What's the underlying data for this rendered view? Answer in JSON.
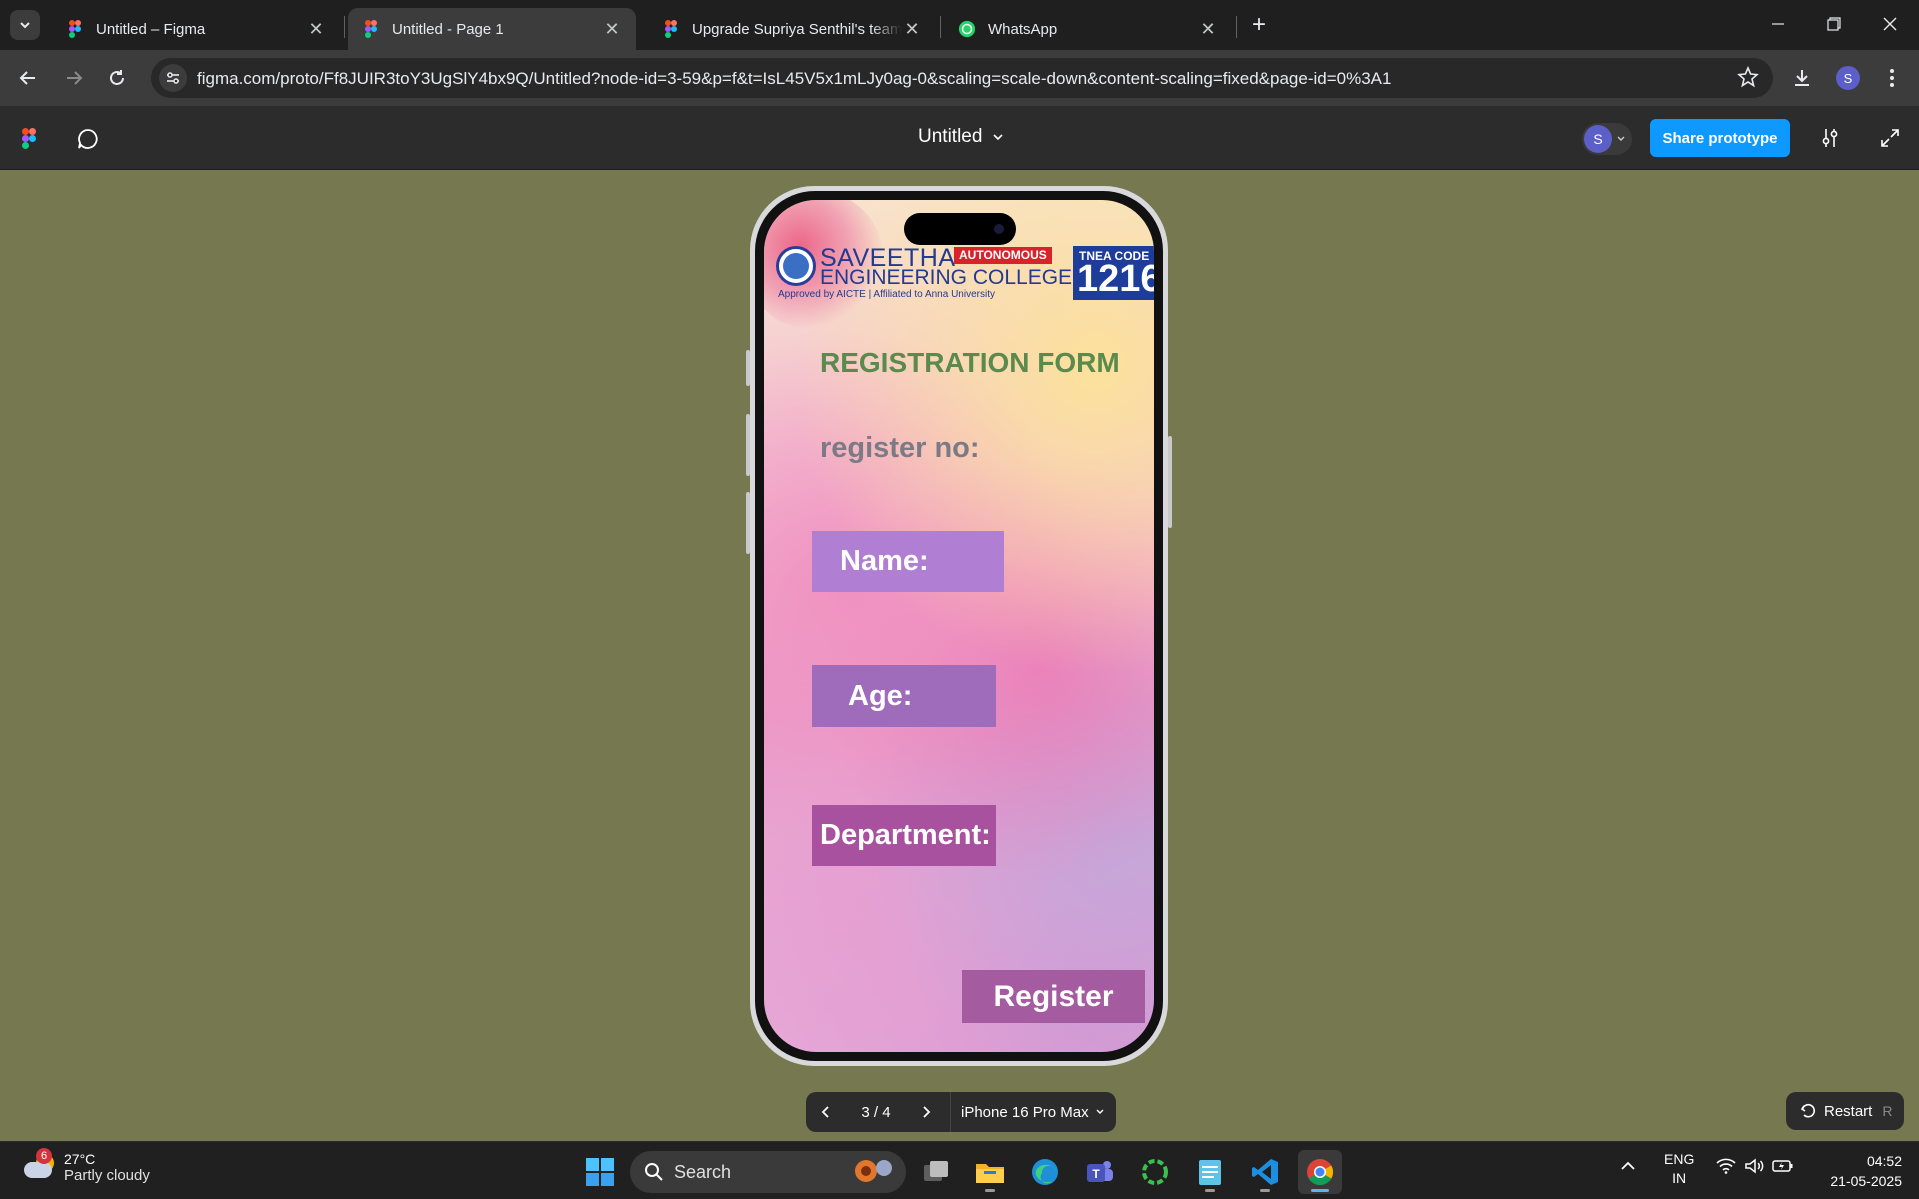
{
  "browser": {
    "tabs": [
      {
        "title": "Untitled – Figma",
        "active": false
      },
      {
        "title": "Untitled - Page 1",
        "active": true
      },
      {
        "title": "Upgrade Supriya Senthil's team",
        "active": false
      },
      {
        "title": "WhatsApp",
        "active": false
      }
    ],
    "url": "figma.com/proto/Ff8JUIR3toY3UgSlY4bx9Q/Untitled?node-id=3-59&p=f&t=IsL45V5x1mLJy0ag-0&scaling=scale-down&content-scaling=fixed&page-id=0%3A1",
    "profile_initial": "S"
  },
  "figma": {
    "file_title": "Untitled",
    "avatar_initial": "S",
    "share_label": "Share prototype",
    "share_color": "#0d99ff"
  },
  "screen": {
    "college_name": "SAVEETHA",
    "autonomous": "AUTONOMOUS",
    "college_sub": "ENGINEERING COLLEGE",
    "affiliation": "Approved by AICTE | Affiliated to Anna University",
    "tnea_label": "TNEA CODE",
    "tnea_code": "1216",
    "form_title": "REGISTRATION FORM",
    "register_no": "register no:",
    "name_label": "Name:",
    "age_label": "Age:",
    "department_label": "Department:",
    "register_button": "Register"
  },
  "prototype": {
    "page_counter": "3 / 4",
    "device": "iPhone 16 Pro Max",
    "restart_label": "Restart",
    "restart_key": "R"
  },
  "taskbar": {
    "weather_temp": "27°C",
    "weather_desc": "Partly cloudy",
    "weather_badge": "6",
    "search_label": "Search",
    "lang1": "ENG",
    "lang2": "IN",
    "time": "04:52",
    "date": "21-05-2025"
  }
}
